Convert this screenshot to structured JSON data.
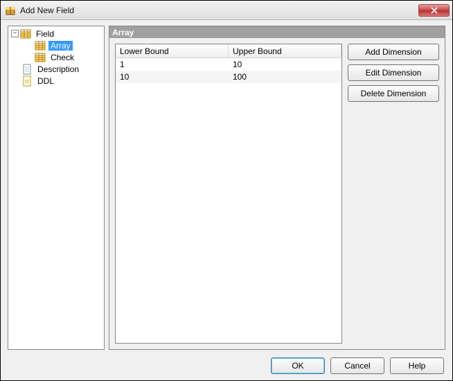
{
  "window": {
    "title": "Add New Field"
  },
  "pane": {
    "header": "Array"
  },
  "tree": {
    "root": {
      "label": "Field",
      "expanded": true
    },
    "children": [
      {
        "label": "Array",
        "selected": true
      },
      {
        "label": "Check"
      }
    ],
    "siblings": [
      {
        "label": "Description"
      },
      {
        "label": "DDL"
      }
    ]
  },
  "table": {
    "columns": [
      "Lower Bound",
      "Upper Bound"
    ],
    "rows": [
      {
        "lower": "1",
        "upper": "10"
      },
      {
        "lower": "10",
        "upper": "100"
      }
    ]
  },
  "buttons": {
    "add": "Add Dimension",
    "edit": "Edit Dimension",
    "delete": "Delete Dimension"
  },
  "footer": {
    "ok": "OK",
    "cancel": "Cancel",
    "help": "Help"
  }
}
